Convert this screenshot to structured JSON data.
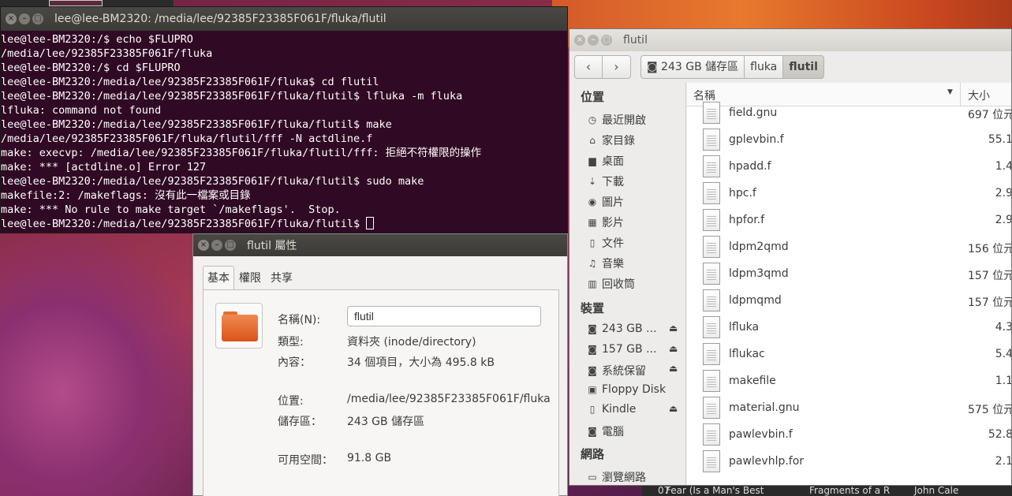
{
  "terminal": {
    "title": "lee@lee-BM2320: /media/lee/92385F23385F061F/fluka/flutil",
    "lines": [
      "lee@lee-BM2320:/$ echo $FLUPRO",
      "/media/lee/92385F23385F061F/fluka",
      "lee@lee-BM2320:/$ cd $FLUPRO",
      "lee@lee-BM2320:/media/lee/92385F23385F061F/fluka$ cd flutil",
      "lee@lee-BM2320:/media/lee/92385F23385F061F/fluka/flutil$ lfluka -m fluka",
      "lfluka: command not found",
      "lee@lee-BM2320:/media/lee/92385F23385F061F/fluka/flutil$ make",
      "/media/lee/92385F23385F061F/fluka/flutil/fff -N actdline.f",
      "make: execvp: /media/lee/92385F23385F061F/fluka/flutil/fff: 拒絕不符權限的操作",
      "make: *** [actdline.o] Error 127",
      "lee@lee-BM2320:/media/lee/92385F23385F061F/fluka/flutil$ sudo make",
      "makefile:2: /makeflags: 沒有此一檔案或目錄",
      "make: *** No rule to make target `/makeflags'.  Stop.",
      "lee@lee-BM2320:/media/lee/92385F23385F061F/fluka/flutil$ "
    ]
  },
  "props": {
    "title": "flutil 屬性",
    "tabs": [
      "基本",
      "權限",
      "共享"
    ],
    "name_label": "名稱(N):",
    "name_value": "flutil",
    "type_label": "類型:",
    "type_value": "資料夾 (inode/directory)",
    "contents_label": "內容：",
    "contents_value": "34 個項目，大小為 495.8 kB",
    "location_label": "位置:",
    "location_value": "/media/lee/92385F23385F061F/fluka",
    "volume_label": "儲存區：",
    "volume_value": "243 GB 儲存區",
    "free_label": "可用空間：",
    "free_value": "91.8 GB"
  },
  "fm": {
    "title": "flutil",
    "crumbs": [
      "243 GB 儲存區",
      "fluka",
      "flutil"
    ],
    "sidebar": {
      "places_header": "位置",
      "places": [
        {
          "label": "最近開啟",
          "icon": "clock-icon"
        },
        {
          "label": "家目錄",
          "icon": "home-icon"
        },
        {
          "label": "桌面",
          "icon": "desktop-icon"
        },
        {
          "label": "下載",
          "icon": "download-icon"
        },
        {
          "label": "圖片",
          "icon": "camera-icon"
        },
        {
          "label": "影片",
          "icon": "film-icon"
        },
        {
          "label": "文件",
          "icon": "document-icon"
        },
        {
          "label": "音樂",
          "icon": "music-icon"
        },
        {
          "label": "回收筒",
          "icon": "trash-icon"
        }
      ],
      "devices_header": "裝置",
      "devices": [
        {
          "label": "243 GB ...",
          "icon": "drive-icon",
          "eject": true
        },
        {
          "label": "157 GB ...",
          "icon": "drive-icon",
          "eject": true
        },
        {
          "label": "系統保留",
          "icon": "drive-icon",
          "eject": true
        },
        {
          "label": "Floppy Disk",
          "icon": "floppy-icon",
          "eject": false
        },
        {
          "label": "Kindle",
          "icon": "usb-icon",
          "eject": true
        },
        {
          "label": "電腦",
          "icon": "computer-icon",
          "eject": false
        }
      ],
      "network_header": "網路",
      "network": [
        {
          "label": "瀏覽網路",
          "icon": "network-icon"
        }
      ]
    },
    "columns": {
      "name": "名稱",
      "size": "大小"
    },
    "files": [
      {
        "name": "field.gnu",
        "size": "697 位元"
      },
      {
        "name": "gplevbin.f",
        "size": "55.1"
      },
      {
        "name": "hpadd.f",
        "size": "1.4"
      },
      {
        "name": "hpc.f",
        "size": "2.9"
      },
      {
        "name": "hpfor.f",
        "size": "2.9"
      },
      {
        "name": "ldpm2qmd",
        "size": "156 位元"
      },
      {
        "name": "ldpm3qmd",
        "size": "157 位元"
      },
      {
        "name": "ldpmqmd",
        "size": "157 位元"
      },
      {
        "name": "lfluka",
        "size": "4.3"
      },
      {
        "name": "lflukac",
        "size": "5.4"
      },
      {
        "name": "makefile",
        "size": "1.1"
      },
      {
        "name": "material.gnu",
        "size": "575 位元"
      },
      {
        "name": "pawlevbin.f",
        "size": "52.8"
      },
      {
        "name": "pawlevhlp.for",
        "size": "2.1"
      }
    ]
  },
  "taskbar": {
    "items": [
      "07",
      "Fear (Is a Man's Best",
      "Fragments of a R",
      "John Cale"
    ]
  }
}
